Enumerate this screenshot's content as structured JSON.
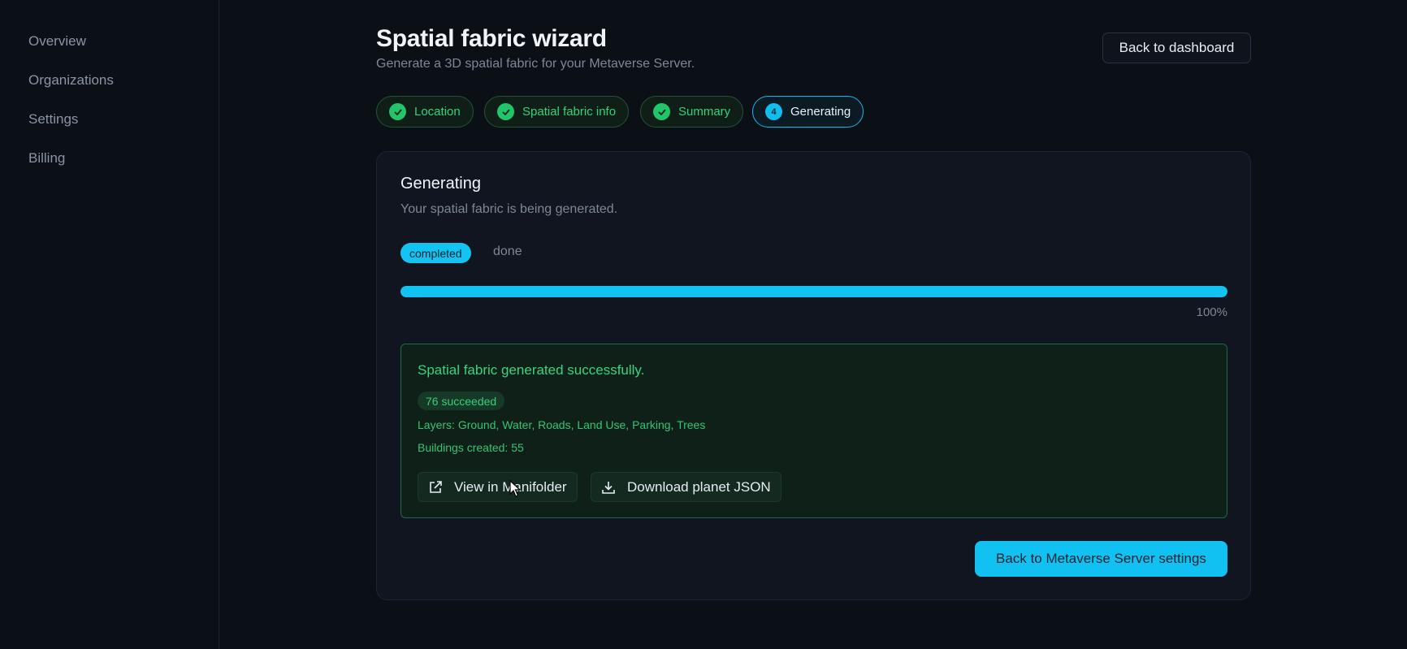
{
  "sidebar": {
    "items": [
      {
        "label": "Overview"
      },
      {
        "label": "Organizations"
      },
      {
        "label": "Settings"
      },
      {
        "label": "Billing"
      }
    ]
  },
  "header": {
    "title": "Spatial fabric wizard",
    "subtitle": "Generate a 3D spatial fabric for your Metaverse Server.",
    "back_button": "Back to dashboard"
  },
  "steps": [
    {
      "label": "Location",
      "status": "done",
      "icon": "check-icon"
    },
    {
      "label": "Spatial fabric info",
      "status": "done",
      "icon": "check-icon"
    },
    {
      "label": "Summary",
      "status": "done",
      "icon": "check-icon"
    },
    {
      "label": "Generating",
      "status": "active",
      "number": "4"
    }
  ],
  "card": {
    "title": "Generating",
    "description": "Your spatial fabric is being generated.",
    "status_badge": "completed",
    "status_text": "done",
    "progress_percent": 100,
    "progress_label": "100%"
  },
  "result": {
    "title": "Spatial fabric generated successfully.",
    "count_badge": "76 succeeded",
    "layers_label": "Layers:",
    "layers_value": "Ground, Water, Roads, Land Use, Parking, Trees",
    "buildings_label": "Buildings created:",
    "buildings_value": "55",
    "view_button": "View in Manifolder",
    "download_button": "Download planet JSON"
  },
  "footer": {
    "primary_button": "Back to Metaverse Server settings"
  },
  "colors": {
    "accent": "#11c2f3",
    "success": "#36cf7a",
    "background": "#0b0f16",
    "card": "#10151f"
  }
}
